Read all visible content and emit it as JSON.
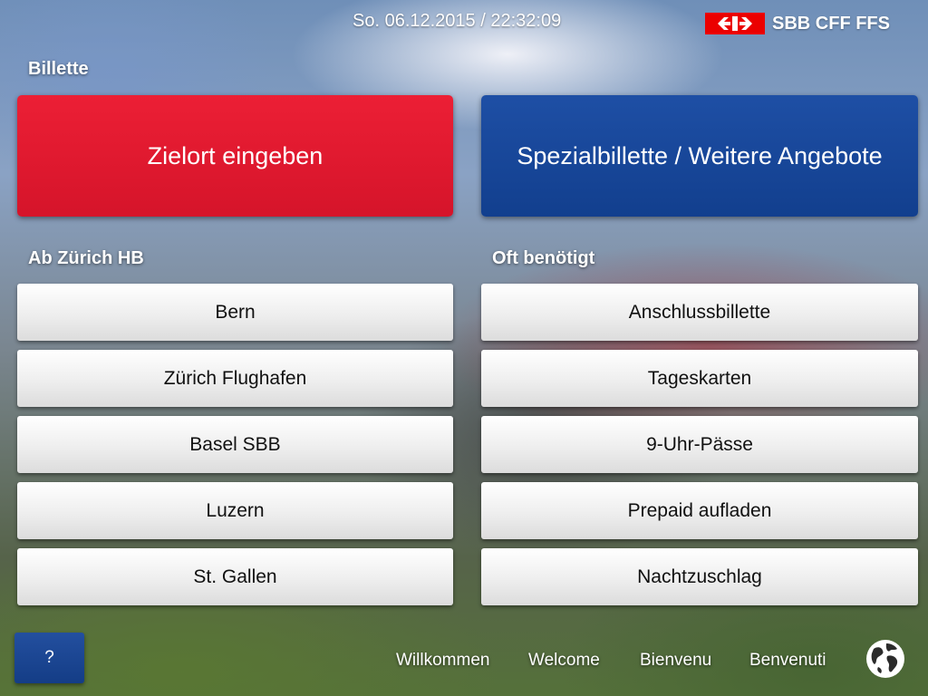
{
  "header": {
    "datetime": "So. 06.12.2015 / 22:32:09",
    "brand": "SBB CFF FFS",
    "brand_color": "#eb0000"
  },
  "sections": {
    "tickets_label": "Billette",
    "from_label": "Ab Zürich HB",
    "frequent_label": "Oft benötigt"
  },
  "primary_buttons": {
    "destination": "Zielort eingeben",
    "special": "Spezialbillette / Weitere Angebote",
    "destination_color": "#e11a30",
    "special_color": "#184596"
  },
  "destinations": [
    "Bern",
    "Zürich Flughafen",
    "Basel SBB",
    "Luzern",
    "St. Gallen"
  ],
  "frequent": [
    "Anschlussbillette",
    "Tageskarten",
    "9-Uhr-Pässe",
    "Prepaid aufladen",
    "Nachtzuschlag"
  ],
  "footer": {
    "help_label": "?",
    "languages": [
      "Willkommen",
      "Welcome",
      "Bienvenu",
      "Benvenuti"
    ],
    "language_icon": "globe-icon"
  }
}
